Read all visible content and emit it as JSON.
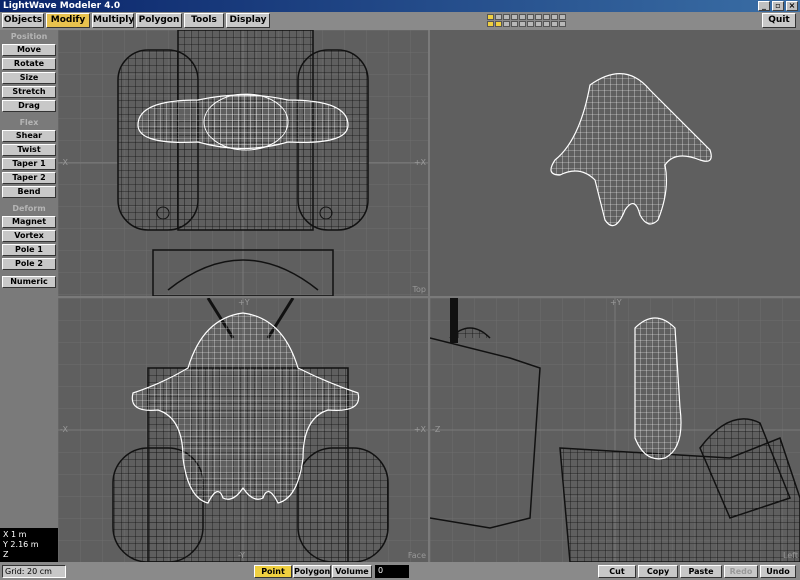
{
  "window": {
    "title": "LightWave Modeler 4.0",
    "controls": [
      "_",
      "▫",
      "×"
    ]
  },
  "tabs": [
    {
      "label": "Objects",
      "active": false
    },
    {
      "label": "Modify",
      "active": true
    },
    {
      "label": "Multiply",
      "active": false
    },
    {
      "label": "Polygon",
      "active": false
    },
    {
      "label": "Tools",
      "active": false
    },
    {
      "label": "Display",
      "active": false
    }
  ],
  "quit_label": "Quit",
  "layer_buttons": {
    "count": 20,
    "active_foreground": [
      1
    ],
    "active_background": [
      11,
      12
    ]
  },
  "sidebar": {
    "groups": [
      {
        "label": "Position",
        "buttons": [
          "Move",
          "Rotate",
          "Size",
          "Stretch",
          "Drag"
        ]
      },
      {
        "label": "Flex",
        "buttons": [
          "Shear",
          "Twist",
          "Taper 1",
          "Taper 2",
          "Bend"
        ]
      },
      {
        "label": "Deform",
        "buttons": [
          "Magnet",
          "Vortex",
          "Pole 1",
          "Pole 2"
        ]
      }
    ],
    "numeric_label": "Numeric"
  },
  "coords": {
    "x": "X 1 m",
    "y": "Y 2.16 m",
    "z": "Z"
  },
  "viewports": {
    "top": {
      "name": "Top",
      "left_axis": "-X",
      "right_axis": "+X"
    },
    "perspective": {
      "top_axis": ""
    },
    "face": {
      "name": "Face",
      "top_axis": "+Y",
      "left_axis": "-X",
      "right_axis": "+X",
      "bottom_axis": "-Y"
    },
    "left": {
      "name": "Left",
      "top_axis": "+Y",
      "left_axis": "-Z"
    }
  },
  "statusbar": {
    "grid": "Grid: 20 cm",
    "modes": [
      {
        "label": "Point",
        "active": true
      },
      {
        "label": "Polygon",
        "active": false
      },
      {
        "label": "Volume",
        "active": false
      }
    ],
    "count": "0",
    "edit_buttons": [
      {
        "label": "Cut",
        "disabled": false
      },
      {
        "label": "Copy",
        "disabled": false
      },
      {
        "label": "Paste",
        "disabled": false
      },
      {
        "label": "Redo",
        "disabled": true
      },
      {
        "label": "Undo",
        "disabled": false
      }
    ]
  }
}
